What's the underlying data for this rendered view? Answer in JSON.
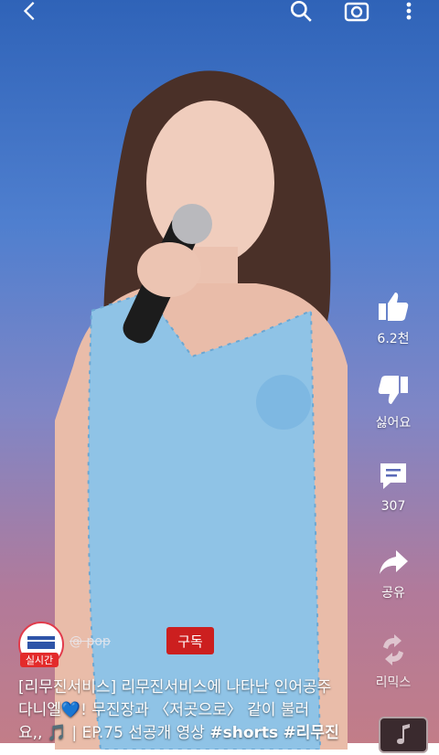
{
  "actions": {
    "like": {
      "label": "6.2천",
      "icon": "thumbs-up-icon"
    },
    "dislike": {
      "label": "싫어요",
      "icon": "thumbs-down-icon"
    },
    "comment": {
      "label": "307",
      "icon": "comment-icon"
    },
    "share": {
      "label": "공유",
      "icon": "share-icon"
    },
    "remix": {
      "label": "리믹스",
      "icon": "remix-icon"
    }
  },
  "channel": {
    "live_label": "실시간",
    "handle": "@ pop",
    "subscribe_label": "구독"
  },
  "caption": {
    "line1": "[리무진서비스] 리무진서비스에 나타난 인어공주",
    "line2": "다니엘💙! 무진장과 〈저곳으로〉 같이 불러",
    "line3_prefix": "요,, 🎵 | EP.75 선공개 영상 ",
    "tag1": "#shorts",
    "tag2": "#리무진"
  },
  "colors": {
    "subscribe_red": "#cc1f1f",
    "live_red": "#e32b2b"
  }
}
